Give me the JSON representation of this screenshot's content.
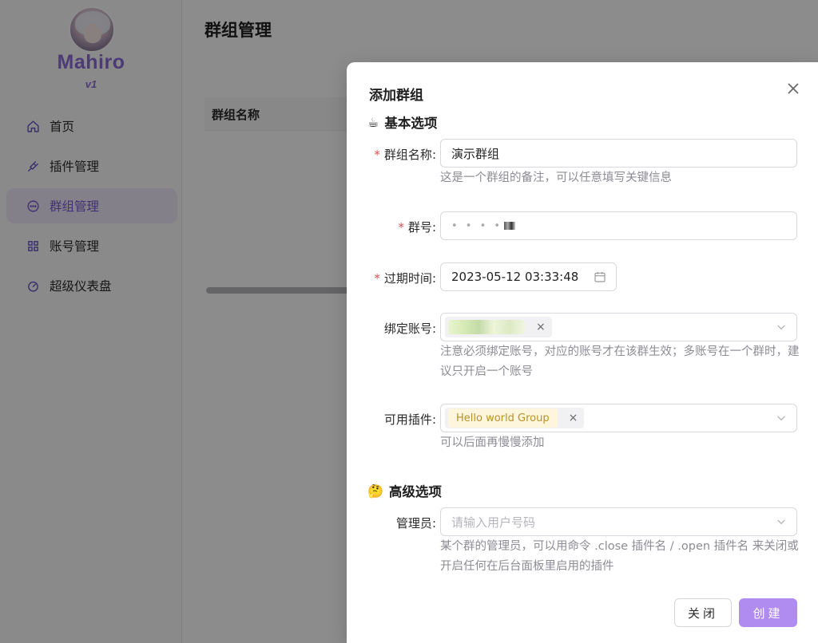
{
  "sidebar": {
    "brand": "Mahiro",
    "version": "v1",
    "items": [
      {
        "label": "首页",
        "icon": "home-icon"
      },
      {
        "label": "插件管理",
        "icon": "plug-icon"
      },
      {
        "label": "群组管理",
        "icon": "chat-icon",
        "active": true
      },
      {
        "label": "账号管理",
        "icon": "grid-icon"
      },
      {
        "label": "超级仪表盘",
        "icon": "dashboard-icon"
      }
    ]
  },
  "main": {
    "title": "群组管理",
    "table": {
      "columns": [
        "群组名称"
      ]
    }
  },
  "modal": {
    "title": "添加群组",
    "basic_section": {
      "emoji": "☕",
      "title": "基本选项"
    },
    "advanced_section": {
      "emoji": "🤔",
      "title": "高级选项"
    },
    "fields": {
      "group_name": {
        "label": "群组名称",
        "required": true,
        "value": "演示群组",
        "help": "这是一个群组的备注，可以任意填写关键信息"
      },
      "group_number": {
        "label": "群号",
        "required": true,
        "value": "• • • •"
      },
      "expire_time": {
        "label": "过期时间",
        "required": true,
        "value": "2023-05-12 03:33:48"
      },
      "bind_account": {
        "label": "绑定账号",
        "required": false,
        "help": "注意必须绑定账号，对应的账号才在该群生效；多账号在一个群时，建议只开启一个账号"
      },
      "plugins": {
        "label": "可用插件",
        "required": false,
        "tag": "Hello world Group",
        "help": "可以后面再慢慢添加"
      },
      "admins": {
        "label": "管理员",
        "required": false,
        "placeholder": "请输入用户号码",
        "help": "某个群的管理员，可以用命令 .close 插件名 / .open 插件名 来关闭或开启任何在后台面板里启用的插件"
      }
    },
    "buttons": {
      "close": "关闭",
      "create": "创建"
    }
  },
  "colors": {
    "accent": "#8a6cd6",
    "primary_button": "#b08cf0",
    "required": "#e05252",
    "plugin_tag_bg": "#fdf6dc"
  }
}
